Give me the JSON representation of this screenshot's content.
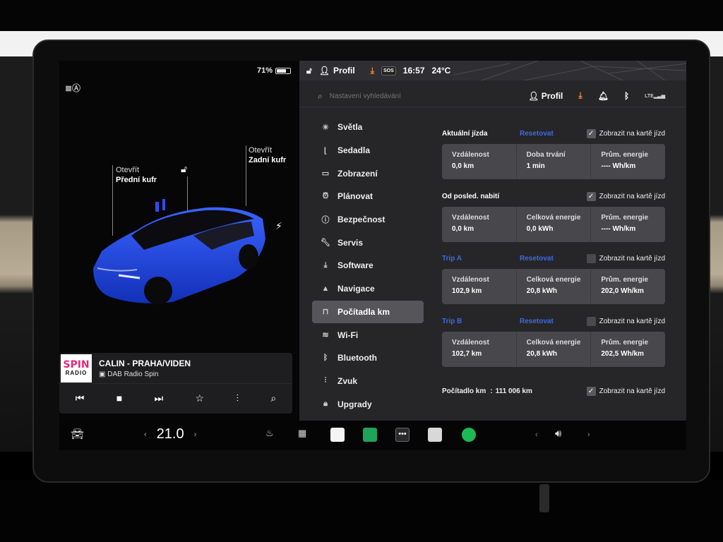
{
  "status": {
    "battery_pct": "71%",
    "battery_level": 0.71,
    "profile": "Profil",
    "sos": "SOS",
    "time": "16:57",
    "outside_temp": "24°C"
  },
  "car": {
    "front_trunk_action": "Otevřít",
    "front_trunk_name": "Přední kufr",
    "rear_trunk_action": "Otevřít",
    "rear_trunk_name": "Zadní kufr"
  },
  "media": {
    "logo_top": "SPIN",
    "logo_bottom": "RADIO",
    "title": "CALIN - PRAHA/VIDEN",
    "source": "DAB Radio Spin"
  },
  "search": {
    "placeholder": "Nastavení vyhledávání",
    "profile": "Profil"
  },
  "nav": {
    "items": [
      {
        "label": "Světla",
        "icon": "sun-icon"
      },
      {
        "label": "Sedadla",
        "icon": "seat-icon"
      },
      {
        "label": "Zobrazení",
        "icon": "display-icon"
      },
      {
        "label": "Plánovat",
        "icon": "alarm-icon"
      },
      {
        "label": "Bezpečnost",
        "icon": "safety-icon"
      },
      {
        "label": "Servis",
        "icon": "wrench-icon"
      },
      {
        "label": "Software",
        "icon": "download-icon"
      },
      {
        "label": "Navigace",
        "icon": "navigation-icon"
      },
      {
        "label": "Počítadla km",
        "icon": "odometer-icon"
      },
      {
        "label": "Wi-Fi",
        "icon": "wifi-icon"
      },
      {
        "label": "Bluetooth",
        "icon": "bluetooth-icon"
      },
      {
        "label": "Zvuk",
        "icon": "equalizer-icon"
      },
      {
        "label": "Upgrady",
        "icon": "lock-icon"
      }
    ],
    "active_index": 8
  },
  "trips": {
    "reset_label": "Resetovat",
    "show_label": "Zobrazit na kartě jízd",
    "current": {
      "title": "Aktuální jízda",
      "checked": true,
      "cells": [
        {
          "label": "Vzdálenost",
          "value": "0,0 km"
        },
        {
          "label": "Doba trvání",
          "value": "1 min"
        },
        {
          "label": "Prům. energie",
          "value": "---- Wh/km"
        }
      ]
    },
    "since_charge": {
      "title": "Od posled. nabití",
      "checked": true,
      "cells": [
        {
          "label": "Vzdálenost",
          "value": "0,0 km"
        },
        {
          "label": "Celková energie",
          "value": "0,0 kWh"
        },
        {
          "label": "Prům. energie",
          "value": "---- Wh/km"
        }
      ]
    },
    "trip_a": {
      "title": "Trip A",
      "checked": false,
      "cells": [
        {
          "label": "Vzdálenost",
          "value": "102,9 km"
        },
        {
          "label": "Celková energie",
          "value": "20,8 kWh"
        },
        {
          "label": "Prům. energie",
          "value": "202,0 Wh/km"
        }
      ]
    },
    "trip_b": {
      "title": "Trip B",
      "checked": false,
      "cells": [
        {
          "label": "Vzdálenost",
          "value": "102,7 km"
        },
        {
          "label": "Celková energie",
          "value": "20,8 kWh"
        },
        {
          "label": "Prům. energie",
          "value": "202,5 Wh/km"
        }
      ]
    },
    "odometer": {
      "label": "Počítadlo km",
      "separator": ":",
      "value": "111 006 km",
      "checked": true
    }
  },
  "bottom": {
    "temperature": "21.0",
    "temp_down": "‹",
    "temp_up": "›",
    "vol_down": "‹",
    "vol_up": "›"
  },
  "colors": {
    "accent_blue": "#3e6ae1",
    "car_blue": "#1d3fd6",
    "download_orange": "#f58b3c",
    "spotify_green": "#1db954"
  }
}
